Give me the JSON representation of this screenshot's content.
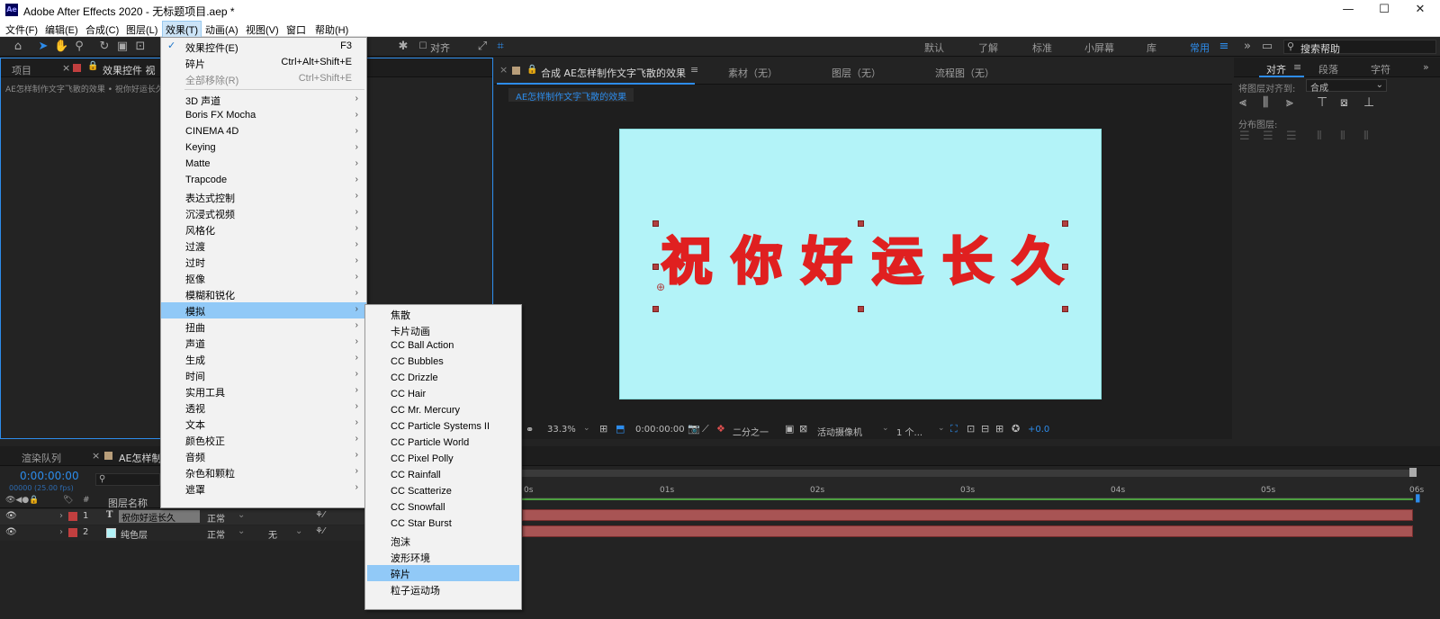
{
  "app": {
    "logo": "Ae",
    "title": "Adobe After Effects 2020 - 无标题项目.aep *"
  },
  "window_controls": {
    "minimize": "—",
    "maximize": "☐",
    "close": "✕"
  },
  "menubar": [
    "文件(F)",
    "编辑(E)",
    "合成(C)",
    "图层(L)",
    "效果(T)",
    "动画(A)",
    "视图(V)",
    "窗口",
    "帮助(H)"
  ],
  "toolbar": {
    "align_label": "对齐",
    "search_placeholder": "搜索帮助"
  },
  "workspaces": [
    "默认",
    "了解",
    "标准",
    "小屏幕",
    "库",
    "常用"
  ],
  "project_panel": {
    "tab1": "项目",
    "tab2": "效果控件 视",
    "breadcrumb": "AE怎样制作文字飞散的效果 • 祝你好运长久"
  },
  "comp_panel": {
    "tab": "合成 AE怎样制作文字飞散的效果",
    "sub_tabs": [
      "素材（无）",
      "图层（无）",
      "流程图（无）"
    ],
    "comp_chip": "AE怎样制作文字飞散的效果",
    "stage_text": [
      "祝",
      "你",
      "好",
      "运",
      "长",
      "久"
    ],
    "footer": {
      "zoom": "33.3%",
      "timecode": "0:00:00:00",
      "resolution": "二分之一",
      "camera": "活动摄像机",
      "views": "1 个...",
      "exposure": "+0.0"
    }
  },
  "right_panel": {
    "tabs": [
      "对齐",
      "段落",
      "字符"
    ],
    "align_to_label": "将图层对齐到:",
    "align_to_value": "合成",
    "distribute_label": "分布图层:"
  },
  "timeline": {
    "tabs": [
      "渲染队列",
      "AE怎样制"
    ],
    "timecode": "0:00:00:00",
    "fps": "00000 (25.00 fps)",
    "column_header": "图层名称",
    "layers": [
      {
        "num": "1",
        "type": "T",
        "name": "祝你好运长久",
        "mode": "正常",
        "color": "#c13f3f",
        "track": ""
      },
      {
        "num": "2",
        "type": "",
        "name": "纯色层",
        "mode": "正常",
        "color": "#c13f3f",
        "track": "无"
      }
    ],
    "ruler": [
      "0s",
      "01s",
      "02s",
      "03s",
      "04s",
      "05s",
      "06s"
    ]
  },
  "effects_menu": [
    {
      "label": "效果控件(E)",
      "shortcut": "F3",
      "checked": true
    },
    {
      "label": "碎片",
      "shortcut": "Ctrl+Alt+Shift+E"
    },
    {
      "label": "全部移除(R)",
      "shortcut": "Ctrl+Shift+E",
      "disabled": true
    },
    {
      "label": "3D 声道",
      "submenu": true
    },
    {
      "label": "Boris FX Mocha",
      "submenu": true
    },
    {
      "label": "CINEMA 4D",
      "submenu": true
    },
    {
      "label": "Keying",
      "submenu": true
    },
    {
      "label": "Matte",
      "submenu": true
    },
    {
      "label": "Trapcode",
      "submenu": true
    },
    {
      "label": "表达式控制",
      "submenu": true
    },
    {
      "label": "沉浸式视频",
      "submenu": true
    },
    {
      "label": "风格化",
      "submenu": true
    },
    {
      "label": "过渡",
      "submenu": true
    },
    {
      "label": "过时",
      "submenu": true
    },
    {
      "label": "抠像",
      "submenu": true
    },
    {
      "label": "模糊和锐化",
      "submenu": true
    },
    {
      "label": "模拟",
      "submenu": true,
      "highlighted": true
    },
    {
      "label": "扭曲",
      "submenu": true
    },
    {
      "label": "声道",
      "submenu": true
    },
    {
      "label": "生成",
      "submenu": true
    },
    {
      "label": "时间",
      "submenu": true
    },
    {
      "label": "实用工具",
      "submenu": true
    },
    {
      "label": "透视",
      "submenu": true
    },
    {
      "label": "文本",
      "submenu": true
    },
    {
      "label": "颜色校正",
      "submenu": true
    },
    {
      "label": "音频",
      "submenu": true
    },
    {
      "label": "杂色和颗粒",
      "submenu": true
    },
    {
      "label": "遮罩",
      "submenu": true
    }
  ],
  "simulate_submenu": [
    {
      "label": "焦散"
    },
    {
      "label": "卡片动画"
    },
    {
      "label": "CC Ball Action"
    },
    {
      "label": "CC Bubbles"
    },
    {
      "label": "CC Drizzle"
    },
    {
      "label": "CC Hair"
    },
    {
      "label": "CC Mr. Mercury"
    },
    {
      "label": "CC Particle Systems II"
    },
    {
      "label": "CC Particle World"
    },
    {
      "label": "CC Pixel Polly"
    },
    {
      "label": "CC Rainfall"
    },
    {
      "label": "CC Scatterize"
    },
    {
      "label": "CC Snowfall"
    },
    {
      "label": "CC Star Burst"
    },
    {
      "label": "泡沫"
    },
    {
      "label": "波形环境"
    },
    {
      "label": "碎片",
      "highlighted": true
    },
    {
      "label": "粒子运动场"
    }
  ],
  "colors": {
    "accent": "#2d8ceb",
    "stage_bg": "#b3f3f8",
    "stage_text": "#e02020",
    "menu_highlight": "#91c9f7",
    "track": "#a85454"
  }
}
